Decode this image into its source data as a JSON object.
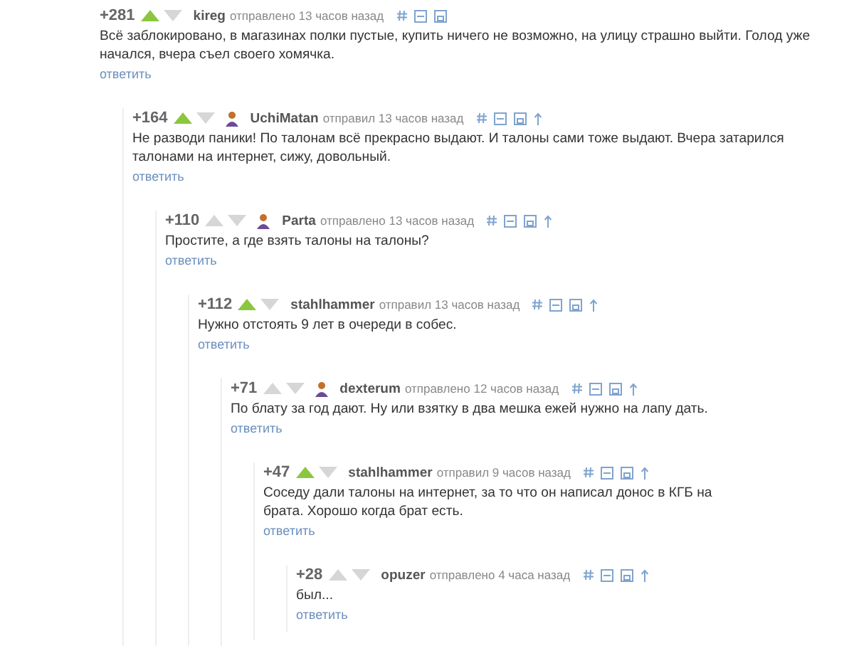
{
  "comments": [
    {
      "rating": "+281",
      "upvoted": true,
      "author": "kireg",
      "avatar": false,
      "time": "отправлено 13 часов назад",
      "parent_link": false,
      "text": "Всё заблокировано, в магазинах полки пустые, купить ничего не возможно, на улицу страшно выйти. Голод уже\nначался, вчера съел своего хомячка.",
      "reply": "ответить",
      "children": [
        {
          "rating": "+164",
          "upvoted": true,
          "author": "UchiMatan",
          "avatar": true,
          "time": "отправил 13 часов назад",
          "parent_link": true,
          "text": "Не разводи паники! По талонам всё прекрасно выдают. И талоны сами тоже выдают. Вчера затарился\nталонами на интернет, сижу, довольный.",
          "reply": "ответить",
          "children": [
            {
              "rating": "+110",
              "upvoted": false,
              "author": "Parta",
              "avatar": true,
              "time": "отправлено 13 часов назад",
              "parent_link": true,
              "text": "Простите, а где взять талоны на талоны?",
              "reply": "ответить",
              "children": [
                {
                  "rating": "+112",
                  "upvoted": true,
                  "author": "stahlhammer",
                  "avatar": false,
                  "time": "отправил 13 часов назад",
                  "parent_link": true,
                  "text": "Нужно отстоять 9 лет в очереди в собес.",
                  "reply": "ответить",
                  "children": [
                    {
                      "rating": "+71",
                      "upvoted": false,
                      "author": "dexterum",
                      "avatar": true,
                      "time": "отправлено 12 часов назад",
                      "parent_link": true,
                      "text": "По блату за год дают. Ну или взятку в два мешка ежей нужно на лапу дать.",
                      "reply": "ответить",
                      "children": [
                        {
                          "rating": "+47",
                          "upvoted": true,
                          "author": "stahlhammer",
                          "avatar": false,
                          "time": "отправил 9 часов назад",
                          "parent_link": true,
                          "text": "Соседу дали талоны на интернет, за то что он написал донос в КГБ на\nбрата. Хорошо когда брат есть.",
                          "reply": "ответить",
                          "children": [
                            {
                              "rating": "+28",
                              "upvoted": false,
                              "author": "opuzer",
                              "avatar": false,
                              "time": "отправлено 4 часа назад",
                              "parent_link": true,
                              "text": "был...",
                              "reply": "ответить"
                            }
                          ]
                        }
                      ]
                    }
                  ]
                }
              ]
            }
          ]
        }
      ]
    }
  ]
}
